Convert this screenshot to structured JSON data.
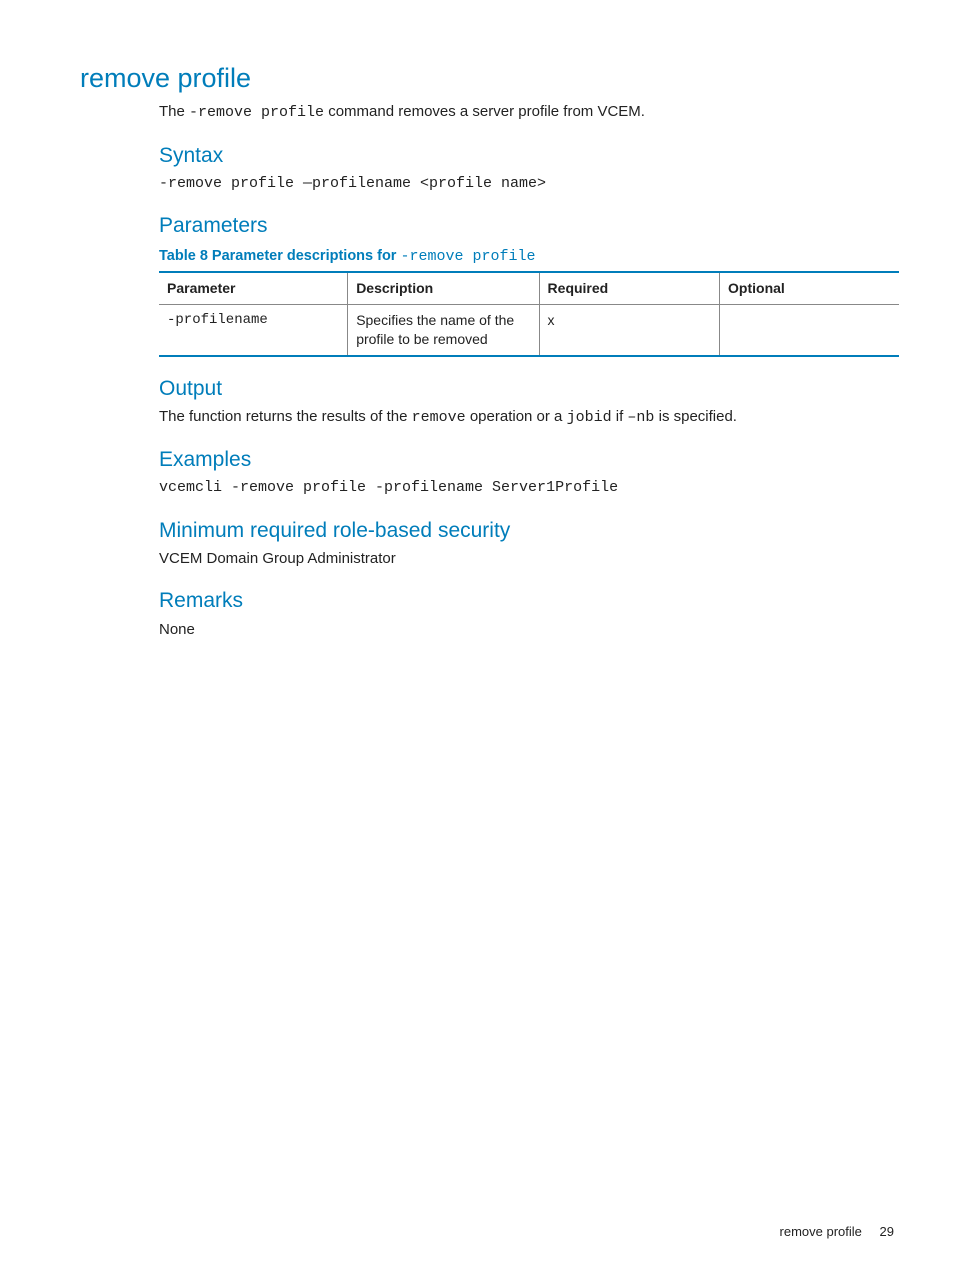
{
  "title": "remove profile",
  "intro": {
    "prefix": "The ",
    "cmd": "-remove profile",
    "suffix": " command removes a server profile from VCEM."
  },
  "syntax": {
    "heading": "Syntax",
    "code": "-remove profile —profilename <profile name>"
  },
  "parameters": {
    "heading": "Parameters",
    "caption_prefix": "Table 8 Parameter descriptions for ",
    "caption_cmd": "-remove profile",
    "headers": {
      "param": "Parameter",
      "desc": "Description",
      "req": "Required",
      "opt": "Optional"
    },
    "row": {
      "param": "-profilename",
      "desc": "Specifies the name of the profile to be removed",
      "req": "x",
      "opt": ""
    }
  },
  "output": {
    "heading": "Output",
    "text_a": "The function returns the results of the ",
    "code_a": "remove",
    "text_b": " operation or a ",
    "code_b": "jobid",
    "text_c": " if ",
    "code_c": "–nb",
    "text_d": " is specified."
  },
  "examples": {
    "heading": "Examples",
    "code": "vcemcli -remove profile -profilename Server1Profile"
  },
  "security": {
    "heading": "Minimum required role-based security",
    "text": "VCEM Domain Group Administrator"
  },
  "remarks": {
    "heading": "Remarks",
    "text": "None"
  },
  "footer": {
    "label": "remove profile",
    "page": "29"
  }
}
